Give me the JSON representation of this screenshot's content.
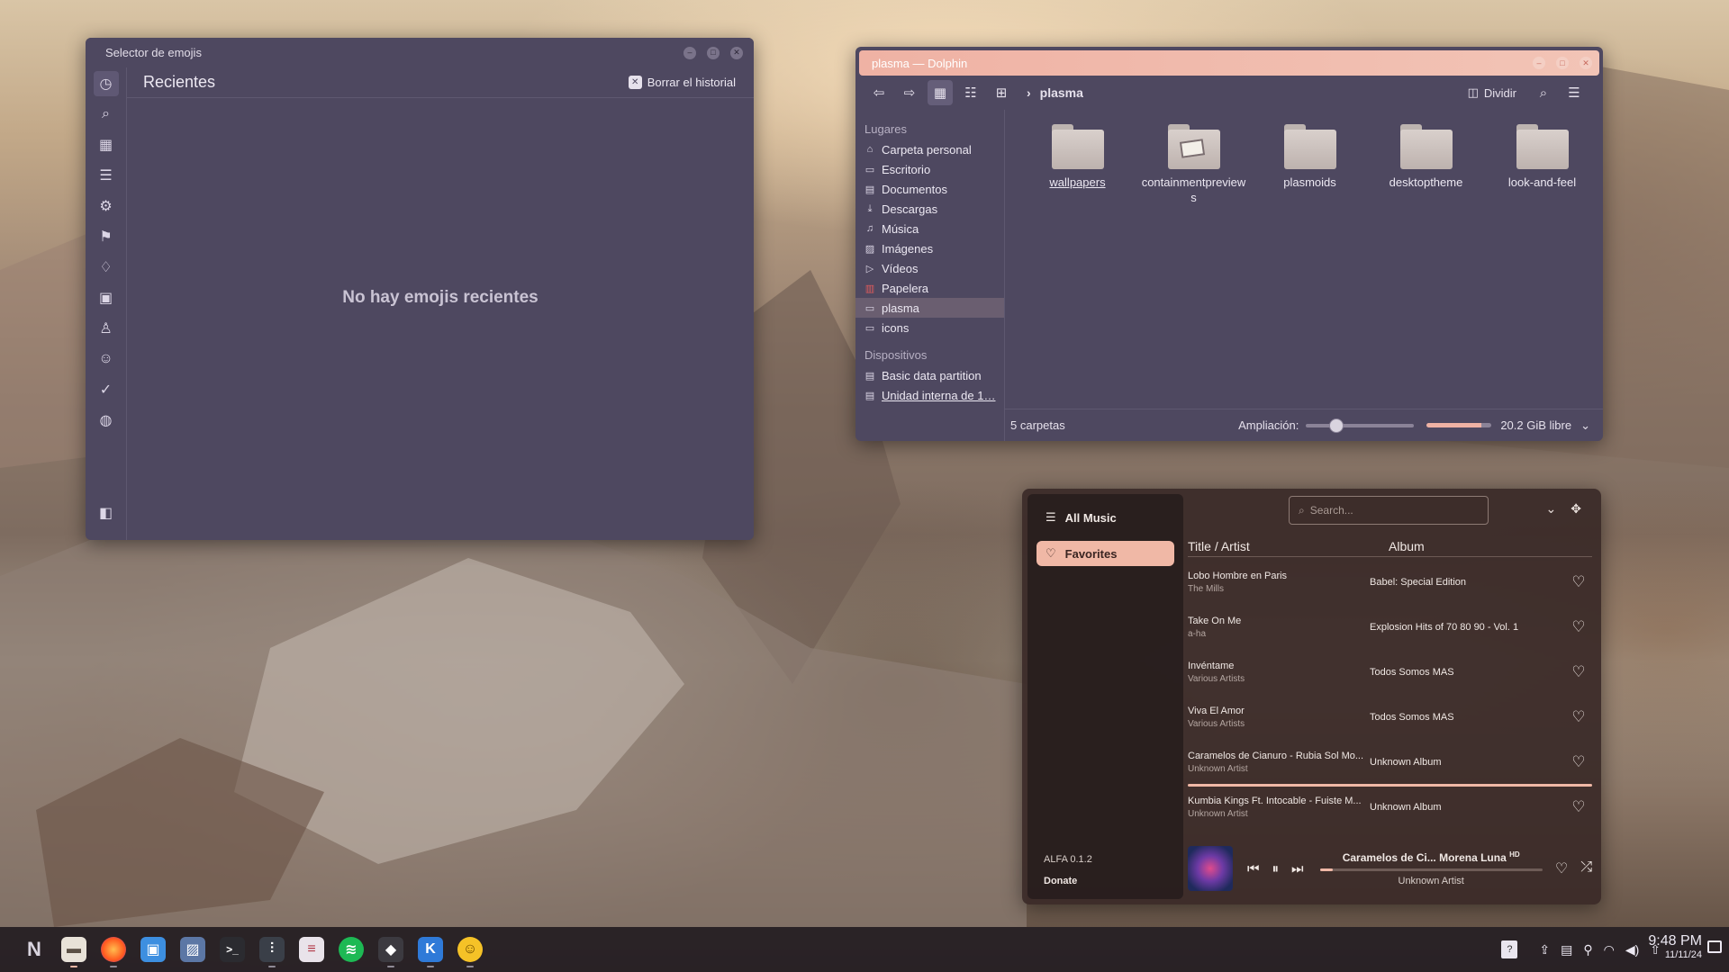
{
  "emoji_window": {
    "title": "Selector de emojis",
    "section_title": "Recientes",
    "clear_history": "Borrar el historial",
    "empty_text": "No hay emojis recientes",
    "sidebar_icons": [
      "clock-icon",
      "search-icon",
      "grid-icon",
      "list-icon",
      "gear-icon",
      "flag-icon",
      "lightbulb-icon",
      "symbols-icon",
      "person-icon",
      "smiley-icon",
      "check-icon",
      "globe-icon"
    ]
  },
  "dolphin": {
    "title": "plasma — Dolphin",
    "breadcrumb": "plasma",
    "split_label": "Dividir",
    "places_header": "Lugares",
    "places": [
      {
        "label": "Carpeta personal",
        "icon": "home-icon"
      },
      {
        "label": "Escritorio",
        "icon": "desktop-icon"
      },
      {
        "label": "Documentos",
        "icon": "document-icon"
      },
      {
        "label": "Descargas",
        "icon": "download-icon"
      },
      {
        "label": "Música",
        "icon": "music-icon"
      },
      {
        "label": "Imágenes",
        "icon": "image-icon"
      },
      {
        "label": "Vídeos",
        "icon": "video-icon"
      },
      {
        "label": "Papelera",
        "icon": "trash-icon"
      },
      {
        "label": "plasma",
        "icon": "folder-icon"
      },
      {
        "label": "icons",
        "icon": "folder-icon"
      }
    ],
    "devices_header": "Dispositivos",
    "devices": [
      {
        "label": "Basic data partition"
      },
      {
        "label": "Unidad interna de 1…"
      }
    ],
    "folders": [
      {
        "name": "wallpapers"
      },
      {
        "name": "containmentpreviews"
      },
      {
        "name": "plasmoids"
      },
      {
        "name": "desktoptheme"
      },
      {
        "name": "look-and-feel"
      }
    ],
    "status_count": "5 carpetas",
    "zoom_label": "Ampliación:",
    "free_space": "20.2 GiB libre"
  },
  "music": {
    "nav": [
      {
        "label": "All Music",
        "icon": "list-icon"
      },
      {
        "label": "Favorites",
        "icon": "heart-icon"
      }
    ],
    "search_placeholder": "Search...",
    "col_title": "Title / Artist",
    "col_album": "Album",
    "tracks": [
      {
        "title": "Lobo Hombre en Paris",
        "artist": "The Mills",
        "album": "Babel: Special Edition"
      },
      {
        "title": "Take On Me",
        "artist": "a-ha",
        "album": "Explosion Hits of 70 80 90 - Vol. 1"
      },
      {
        "title": "Invéntame",
        "artist": "Various Artists",
        "album": "Todos Somos MAS"
      },
      {
        "title": "Viva El Amor",
        "artist": "Various Artists",
        "album": "Todos Somos MAS"
      },
      {
        "title": "Caramelos de Cianuro - Rubia Sol Mo...",
        "artist": "Unknown Artist",
        "album": "Unknown Album"
      },
      {
        "title": "Kumbia Kings Ft. Intocable - Fuiste M...",
        "artist": "Unknown Artist",
        "album": "Unknown Album"
      }
    ],
    "version": "ALFA 0.1.2",
    "donate": "Donate",
    "now_playing_title": "Caramelos de Ci... Morena Luna",
    "now_playing_badge": "HD",
    "now_playing_artist": "Unknown Artist",
    "progress_fraction": 0.06
  },
  "taskbar": {
    "time": "9:48 PM",
    "date": "11/11/24"
  },
  "colors": {
    "accent": "#f0b8a6",
    "window_bg": "#4e4860",
    "dolphin_title": "#efb2a4"
  }
}
